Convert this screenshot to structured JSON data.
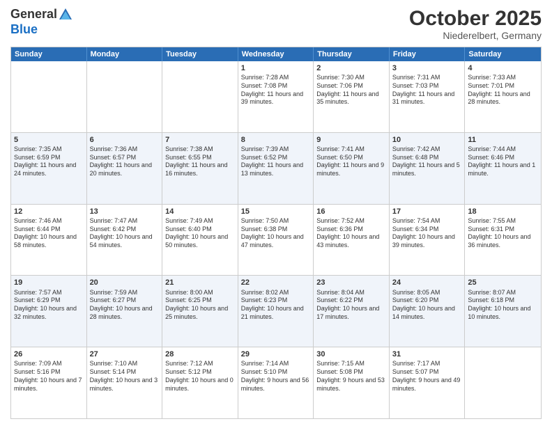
{
  "header": {
    "logo_line1": "General",
    "logo_line2": "Blue",
    "month": "October 2025",
    "location": "Niederelbert, Germany"
  },
  "weekdays": [
    "Sunday",
    "Monday",
    "Tuesday",
    "Wednesday",
    "Thursday",
    "Friday",
    "Saturday"
  ],
  "rows": [
    {
      "alt": false,
      "cells": [
        {
          "day": "",
          "info": ""
        },
        {
          "day": "",
          "info": ""
        },
        {
          "day": "",
          "info": ""
        },
        {
          "day": "1",
          "info": "Sunrise: 7:28 AM\nSunset: 7:08 PM\nDaylight: 11 hours and 39 minutes."
        },
        {
          "day": "2",
          "info": "Sunrise: 7:30 AM\nSunset: 7:06 PM\nDaylight: 11 hours and 35 minutes."
        },
        {
          "day": "3",
          "info": "Sunrise: 7:31 AM\nSunset: 7:03 PM\nDaylight: 11 hours and 31 minutes."
        },
        {
          "day": "4",
          "info": "Sunrise: 7:33 AM\nSunset: 7:01 PM\nDaylight: 11 hours and 28 minutes."
        }
      ]
    },
    {
      "alt": true,
      "cells": [
        {
          "day": "5",
          "info": "Sunrise: 7:35 AM\nSunset: 6:59 PM\nDaylight: 11 hours and 24 minutes."
        },
        {
          "day": "6",
          "info": "Sunrise: 7:36 AM\nSunset: 6:57 PM\nDaylight: 11 hours and 20 minutes."
        },
        {
          "day": "7",
          "info": "Sunrise: 7:38 AM\nSunset: 6:55 PM\nDaylight: 11 hours and 16 minutes."
        },
        {
          "day": "8",
          "info": "Sunrise: 7:39 AM\nSunset: 6:52 PM\nDaylight: 11 hours and 13 minutes."
        },
        {
          "day": "9",
          "info": "Sunrise: 7:41 AM\nSunset: 6:50 PM\nDaylight: 11 hours and 9 minutes."
        },
        {
          "day": "10",
          "info": "Sunrise: 7:42 AM\nSunset: 6:48 PM\nDaylight: 11 hours and 5 minutes."
        },
        {
          "day": "11",
          "info": "Sunrise: 7:44 AM\nSunset: 6:46 PM\nDaylight: 11 hours and 1 minute."
        }
      ]
    },
    {
      "alt": false,
      "cells": [
        {
          "day": "12",
          "info": "Sunrise: 7:46 AM\nSunset: 6:44 PM\nDaylight: 10 hours and 58 minutes."
        },
        {
          "day": "13",
          "info": "Sunrise: 7:47 AM\nSunset: 6:42 PM\nDaylight: 10 hours and 54 minutes."
        },
        {
          "day": "14",
          "info": "Sunrise: 7:49 AM\nSunset: 6:40 PM\nDaylight: 10 hours and 50 minutes."
        },
        {
          "day": "15",
          "info": "Sunrise: 7:50 AM\nSunset: 6:38 PM\nDaylight: 10 hours and 47 minutes."
        },
        {
          "day": "16",
          "info": "Sunrise: 7:52 AM\nSunset: 6:36 PM\nDaylight: 10 hours and 43 minutes."
        },
        {
          "day": "17",
          "info": "Sunrise: 7:54 AM\nSunset: 6:34 PM\nDaylight: 10 hours and 39 minutes."
        },
        {
          "day": "18",
          "info": "Sunrise: 7:55 AM\nSunset: 6:31 PM\nDaylight: 10 hours and 36 minutes."
        }
      ]
    },
    {
      "alt": true,
      "cells": [
        {
          "day": "19",
          "info": "Sunrise: 7:57 AM\nSunset: 6:29 PM\nDaylight: 10 hours and 32 minutes."
        },
        {
          "day": "20",
          "info": "Sunrise: 7:59 AM\nSunset: 6:27 PM\nDaylight: 10 hours and 28 minutes."
        },
        {
          "day": "21",
          "info": "Sunrise: 8:00 AM\nSunset: 6:25 PM\nDaylight: 10 hours and 25 minutes."
        },
        {
          "day": "22",
          "info": "Sunrise: 8:02 AM\nSunset: 6:23 PM\nDaylight: 10 hours and 21 minutes."
        },
        {
          "day": "23",
          "info": "Sunrise: 8:04 AM\nSunset: 6:22 PM\nDaylight: 10 hours and 17 minutes."
        },
        {
          "day": "24",
          "info": "Sunrise: 8:05 AM\nSunset: 6:20 PM\nDaylight: 10 hours and 14 minutes."
        },
        {
          "day": "25",
          "info": "Sunrise: 8:07 AM\nSunset: 6:18 PM\nDaylight: 10 hours and 10 minutes."
        }
      ]
    },
    {
      "alt": false,
      "cells": [
        {
          "day": "26",
          "info": "Sunrise: 7:09 AM\nSunset: 5:16 PM\nDaylight: 10 hours and 7 minutes."
        },
        {
          "day": "27",
          "info": "Sunrise: 7:10 AM\nSunset: 5:14 PM\nDaylight: 10 hours and 3 minutes."
        },
        {
          "day": "28",
          "info": "Sunrise: 7:12 AM\nSunset: 5:12 PM\nDaylight: 10 hours and 0 minutes."
        },
        {
          "day": "29",
          "info": "Sunrise: 7:14 AM\nSunset: 5:10 PM\nDaylight: 9 hours and 56 minutes."
        },
        {
          "day": "30",
          "info": "Sunrise: 7:15 AM\nSunset: 5:08 PM\nDaylight: 9 hours and 53 minutes."
        },
        {
          "day": "31",
          "info": "Sunrise: 7:17 AM\nSunset: 5:07 PM\nDaylight: 9 hours and 49 minutes."
        },
        {
          "day": "",
          "info": ""
        }
      ]
    }
  ]
}
